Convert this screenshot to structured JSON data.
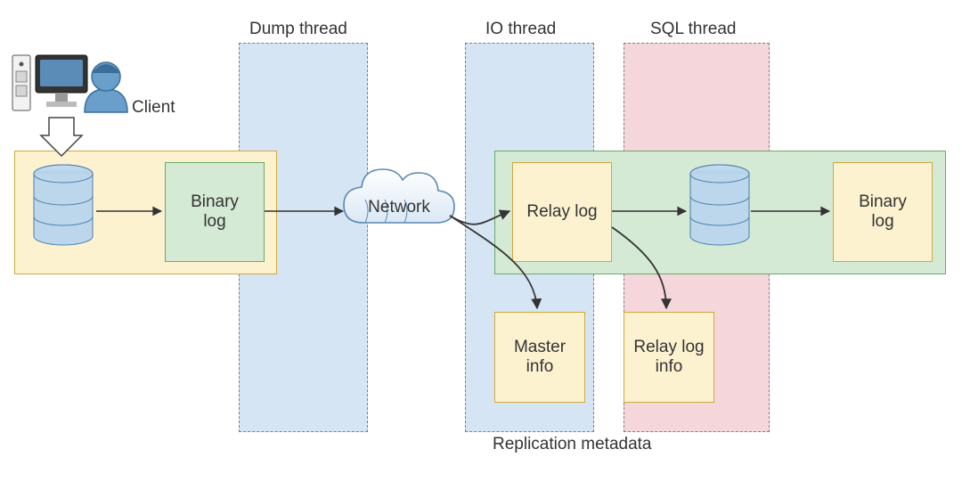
{
  "labels": {
    "client": "Client",
    "dump_thread": "Dump thread",
    "io_thread": "IO thread",
    "sql_thread": "SQL thread",
    "network": "Network",
    "replication_metadata": "Replication metadata"
  },
  "master": {
    "binary_log": "Binary\nlog"
  },
  "slave": {
    "relay_log": "Relay log",
    "binary_log": "Binary\nlog"
  },
  "meta": {
    "master_info": "Master\ninfo",
    "relay_log_info": "Relay log\ninfo"
  },
  "chart_data": {
    "type": "flow-diagram",
    "title": "MySQL replication threads and logs",
    "nodes": [
      {
        "id": "client",
        "label": "Client",
        "kind": "actor"
      },
      {
        "id": "master_db",
        "label": "Master DB",
        "kind": "database"
      },
      {
        "id": "master_binlog",
        "label": "Binary log",
        "kind": "file",
        "group": "master"
      },
      {
        "id": "network",
        "label": "Network",
        "kind": "cloud"
      },
      {
        "id": "relay_log",
        "label": "Relay log",
        "kind": "file",
        "group": "slave"
      },
      {
        "id": "slave_db",
        "label": "Slave DB",
        "kind": "database",
        "group": "slave"
      },
      {
        "id": "slave_binlog",
        "label": "Binary log",
        "kind": "file",
        "group": "slave"
      },
      {
        "id": "master_info",
        "label": "Master info",
        "kind": "file",
        "group": "replication-metadata"
      },
      {
        "id": "relay_log_info",
        "label": "Relay log info",
        "kind": "file",
        "group": "replication-metadata"
      }
    ],
    "lanes": [
      {
        "id": "dump_thread",
        "label": "Dump thread"
      },
      {
        "id": "io_thread",
        "label": "IO thread"
      },
      {
        "id": "sql_thread",
        "label": "SQL thread"
      }
    ],
    "edges": [
      {
        "from": "client",
        "to": "master_db"
      },
      {
        "from": "master_db",
        "to": "master_binlog"
      },
      {
        "from": "master_binlog",
        "to": "network",
        "lane": "dump_thread"
      },
      {
        "from": "network",
        "to": "relay_log",
        "lane": "io_thread"
      },
      {
        "from": "network",
        "to": "master_info",
        "lane": "io_thread"
      },
      {
        "from": "relay_log",
        "to": "slave_db",
        "lane": "sql_thread"
      },
      {
        "from": "relay_log",
        "to": "relay_log_info",
        "lane": "sql_thread"
      },
      {
        "from": "slave_db",
        "to": "slave_binlog"
      }
    ]
  }
}
